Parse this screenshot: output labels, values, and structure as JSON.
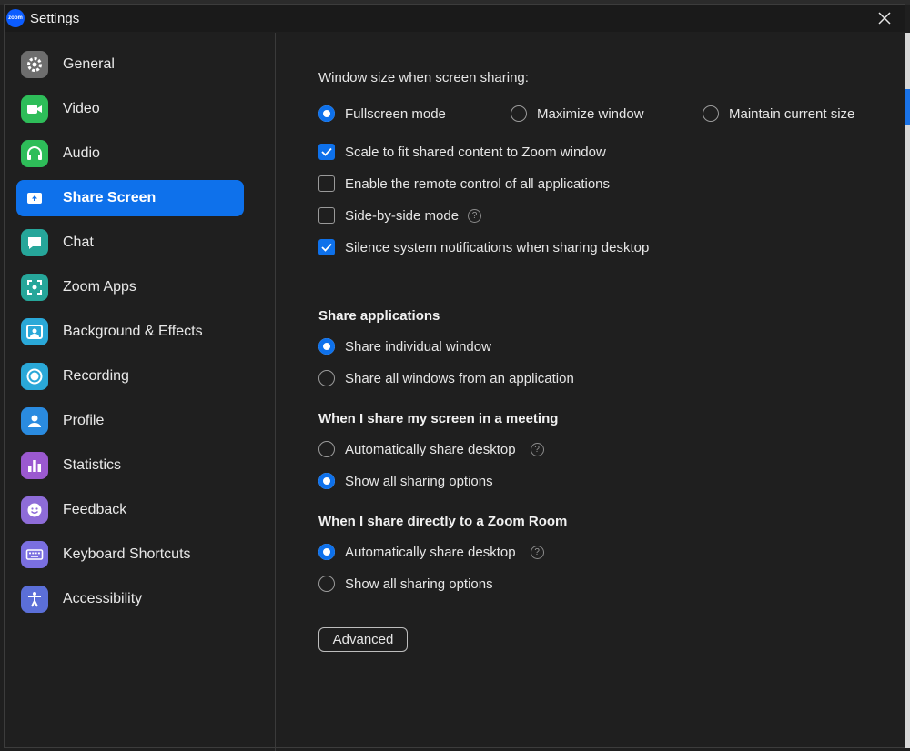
{
  "window": {
    "title": "Settings",
    "logo_text": "zoom"
  },
  "sidebar": {
    "items": [
      {
        "label": "General",
        "icon": "gear-icon",
        "color": "#6e6e6e"
      },
      {
        "label": "Video",
        "icon": "video-camera-icon",
        "color": "#2ebd59"
      },
      {
        "label": "Audio",
        "icon": "headphones-icon",
        "color": "#2ebd59"
      },
      {
        "label": "Share Screen",
        "icon": "share-screen-icon",
        "color": "#0e71eb"
      },
      {
        "label": "Chat",
        "icon": "chat-bubble-icon",
        "color": "#26a69a"
      },
      {
        "label": "Zoom Apps",
        "icon": "apps-icon",
        "color": "#26a69a"
      },
      {
        "label": "Background & Effects",
        "icon": "background-person-icon",
        "color": "#2aa8d8"
      },
      {
        "label": "Recording",
        "icon": "record-icon",
        "color": "#2aa8d8"
      },
      {
        "label": "Profile",
        "icon": "person-icon",
        "color": "#2a8be0"
      },
      {
        "label": "Statistics",
        "icon": "bar-chart-icon",
        "color": "#9b59d0"
      },
      {
        "label": "Feedback",
        "icon": "smiley-icon",
        "color": "#8e6cd8"
      },
      {
        "label": "Keyboard Shortcuts",
        "icon": "keyboard-icon",
        "color": "#7a6fe0"
      },
      {
        "label": "Accessibility",
        "icon": "accessibility-icon",
        "color": "#5b6fd8"
      }
    ],
    "active_index": 3
  },
  "share": {
    "window_size_label": "Window size when screen sharing:",
    "window_size_options": [
      {
        "label": "Fullscreen mode",
        "selected": true
      },
      {
        "label": "Maximize window",
        "selected": false
      },
      {
        "label": "Maintain current size",
        "selected": false
      }
    ],
    "checkboxes": [
      {
        "label": "Scale to fit shared content to Zoom window",
        "checked": true
      },
      {
        "label": "Enable the remote control of all applications",
        "checked": false
      },
      {
        "label": "Side-by-side mode",
        "checked": false,
        "help": true
      },
      {
        "label": "Silence system notifications when sharing desktop",
        "checked": true
      }
    ],
    "share_apps": {
      "heading": "Share applications",
      "options": [
        {
          "label": "Share individual window",
          "selected": true
        },
        {
          "label": "Share all windows from an application",
          "selected": false
        }
      ]
    },
    "meeting": {
      "heading": "When I share my screen in a meeting",
      "options": [
        {
          "label": "Automatically share desktop",
          "selected": false,
          "help": true
        },
        {
          "label": "Show all sharing options",
          "selected": true
        }
      ]
    },
    "zoom_room": {
      "heading": "When I share directly to a Zoom Room",
      "options": [
        {
          "label": "Automatically share desktop",
          "selected": true,
          "help": true
        },
        {
          "label": "Show all sharing options",
          "selected": false
        }
      ]
    },
    "advanced_label": "Advanced",
    "help_glyph": "?"
  },
  "colors": {
    "accent": "#0e71eb",
    "background": "#1f1f1f"
  }
}
